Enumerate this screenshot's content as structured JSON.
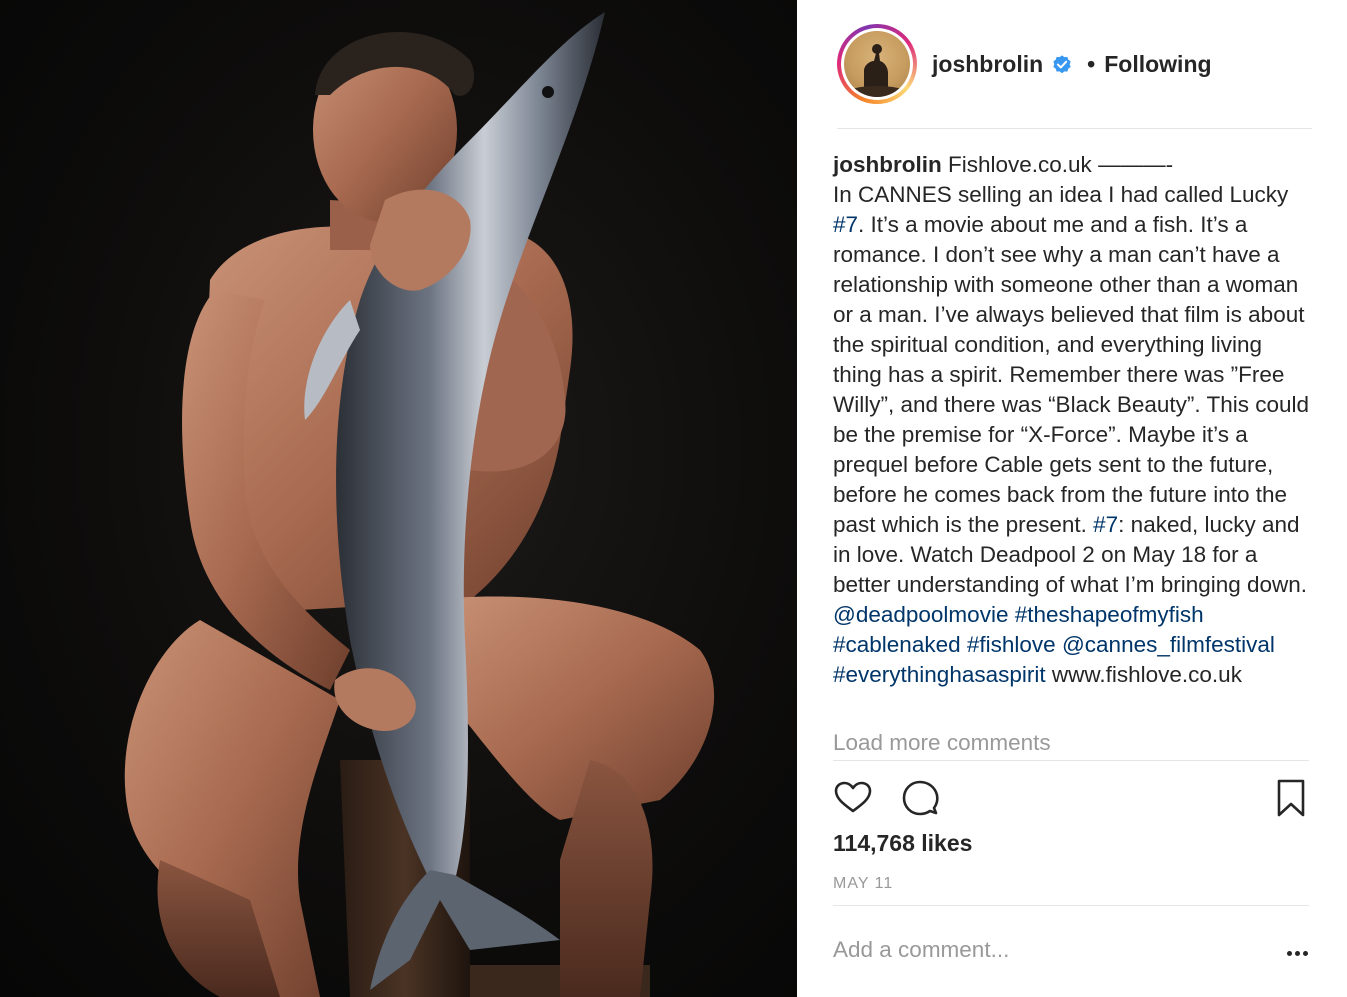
{
  "post": {
    "author": {
      "username": "joshbrolin",
      "verified": true,
      "follow_status": "Following",
      "separator": "•"
    },
    "caption": {
      "username": "joshbrolin",
      "segments": [
        {
          "type": "text",
          "text": " Fishlove.co.uk ———-"
        },
        {
          "type": "br"
        },
        {
          "type": "text",
          "text": "In CANNES selling an idea I had called Lucky "
        },
        {
          "type": "tag",
          "text": "#7"
        },
        {
          "type": "text",
          "text": ". It’s a movie about me and a fish. It’s a romance. I don’t see why a man can’t have a relationship with someone other than a woman or a man. I’ve always believed that film is about the spiritual condition, and everything living thing has a spirit. Remember there was ”Free Willy”, and there was “Black Beauty”. This could be the premise for “X-Force”. Maybe it’s a prequel before Cable gets sent to the future, before he comes back from the future into the past which is the present. "
        },
        {
          "type": "tag",
          "text": "#7"
        },
        {
          "type": "text",
          "text": ": naked, lucky and in love. Watch Deadpool 2 on May 18 for a better understanding of what I’m bringing down. "
        },
        {
          "type": "tag",
          "text": "@deadpoolmovie"
        },
        {
          "type": "text",
          "text": " "
        },
        {
          "type": "tag",
          "text": "#theshapeofmyfish"
        },
        {
          "type": "text",
          "text": " "
        },
        {
          "type": "tag",
          "text": "#cablenaked"
        },
        {
          "type": "text",
          "text": " "
        },
        {
          "type": "tag",
          "text": "#fishlove"
        },
        {
          "type": "text",
          "text": " "
        },
        {
          "type": "tag",
          "text": "@cannes_filmfestival"
        },
        {
          "type": "text",
          "text": " "
        },
        {
          "type": "tag",
          "text": "#everythinghasaspirit"
        },
        {
          "type": "text",
          "text": " www.fishlove.co.uk"
        }
      ]
    },
    "load_more_label": "Load more comments",
    "actions": {
      "like_icon": "heart-icon",
      "comment_icon": "comment-bubble-icon",
      "save_icon": "bookmark-icon"
    },
    "likes_label": "114,768 likes",
    "date_label": "MAY 11",
    "comment_placeholder": "Add a comment...",
    "more_icon": "more-dots-icon"
  },
  "colors": {
    "text": "#262626",
    "muted": "#999999",
    "tag": "#003569",
    "verified": "#3897f0",
    "divider": "#e6e6e6"
  }
}
